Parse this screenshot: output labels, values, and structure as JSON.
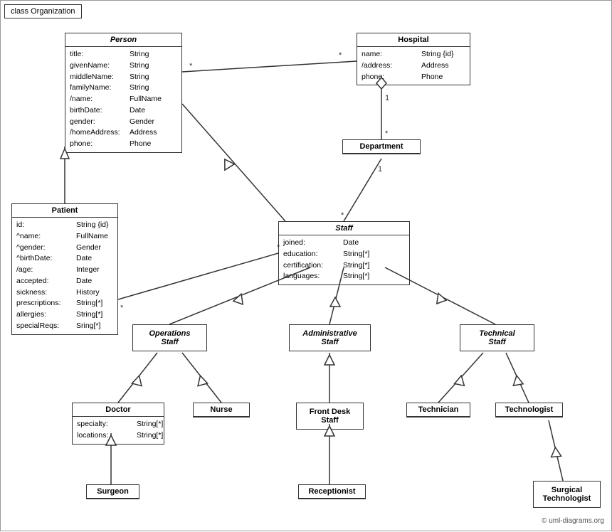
{
  "title": "class Organization",
  "copyright": "© uml-diagrams.org",
  "classes": {
    "person": {
      "name": "Person",
      "italic": true,
      "attributes": [
        {
          "name": "title:",
          "type": "String"
        },
        {
          "name": "givenName:",
          "type": "String"
        },
        {
          "name": "middleName:",
          "type": "String"
        },
        {
          "name": "familyName:",
          "type": "String"
        },
        {
          "name": "/name:",
          "type": "FullName"
        },
        {
          "name": "birthDate:",
          "type": "Date"
        },
        {
          "name": "gender:",
          "type": "Gender"
        },
        {
          "name": "/homeAddress:",
          "type": "Address"
        },
        {
          "name": "phone:",
          "type": "Phone"
        }
      ]
    },
    "hospital": {
      "name": "Hospital",
      "italic": false,
      "attributes": [
        {
          "name": "name:",
          "type": "String {id}"
        },
        {
          "name": "/address:",
          "type": "Address"
        },
        {
          "name": "phone:",
          "type": "Phone"
        }
      ]
    },
    "department": {
      "name": "Department",
      "italic": false,
      "attributes": []
    },
    "staff": {
      "name": "Staff",
      "italic": true,
      "attributes": [
        {
          "name": "joined:",
          "type": "Date"
        },
        {
          "name": "education:",
          "type": "String[*]"
        },
        {
          "name": "certification:",
          "type": "String[*]"
        },
        {
          "name": "languages:",
          "type": "String[*]"
        }
      ]
    },
    "patient": {
      "name": "Patient",
      "italic": false,
      "attributes": [
        {
          "name": "id:",
          "type": "String {id}"
        },
        {
          "name": "^name:",
          "type": "FullName"
        },
        {
          "name": "^gender:",
          "type": "Gender"
        },
        {
          "name": "^birthDate:",
          "type": "Date"
        },
        {
          "name": "/age:",
          "type": "Integer"
        },
        {
          "name": "accepted:",
          "type": "Date"
        },
        {
          "name": "sickness:",
          "type": "History"
        },
        {
          "name": "prescriptions:",
          "type": "String[*]"
        },
        {
          "name": "allergies:",
          "type": "String[*]"
        },
        {
          "name": "specialReqs:",
          "type": "Sring[*]"
        }
      ]
    },
    "operationsStaff": {
      "name": "Operations\nStaff",
      "italic": true,
      "attributes": []
    },
    "administrativeStaff": {
      "name": "Administrative\nStaff",
      "italic": true,
      "attributes": []
    },
    "technicalStaff": {
      "name": "Technical\nStaff",
      "italic": true,
      "attributes": []
    },
    "doctor": {
      "name": "Doctor",
      "italic": false,
      "attributes": [
        {
          "name": "specialty:",
          "type": "String[*]"
        },
        {
          "name": "locations:",
          "type": "String[*]"
        }
      ]
    },
    "nurse": {
      "name": "Nurse",
      "italic": false,
      "attributes": []
    },
    "frontDeskStaff": {
      "name": "Front Desk\nStaff",
      "italic": false,
      "attributes": []
    },
    "technician": {
      "name": "Technician",
      "italic": false,
      "attributes": []
    },
    "technologist": {
      "name": "Technologist",
      "italic": false,
      "attributes": []
    },
    "surgeon": {
      "name": "Surgeon",
      "italic": false,
      "attributes": []
    },
    "receptionist": {
      "name": "Receptionist",
      "italic": false,
      "attributes": []
    },
    "surgicalTechnologist": {
      "name": "Surgical\nTechnologist",
      "italic": false,
      "attributes": []
    }
  }
}
